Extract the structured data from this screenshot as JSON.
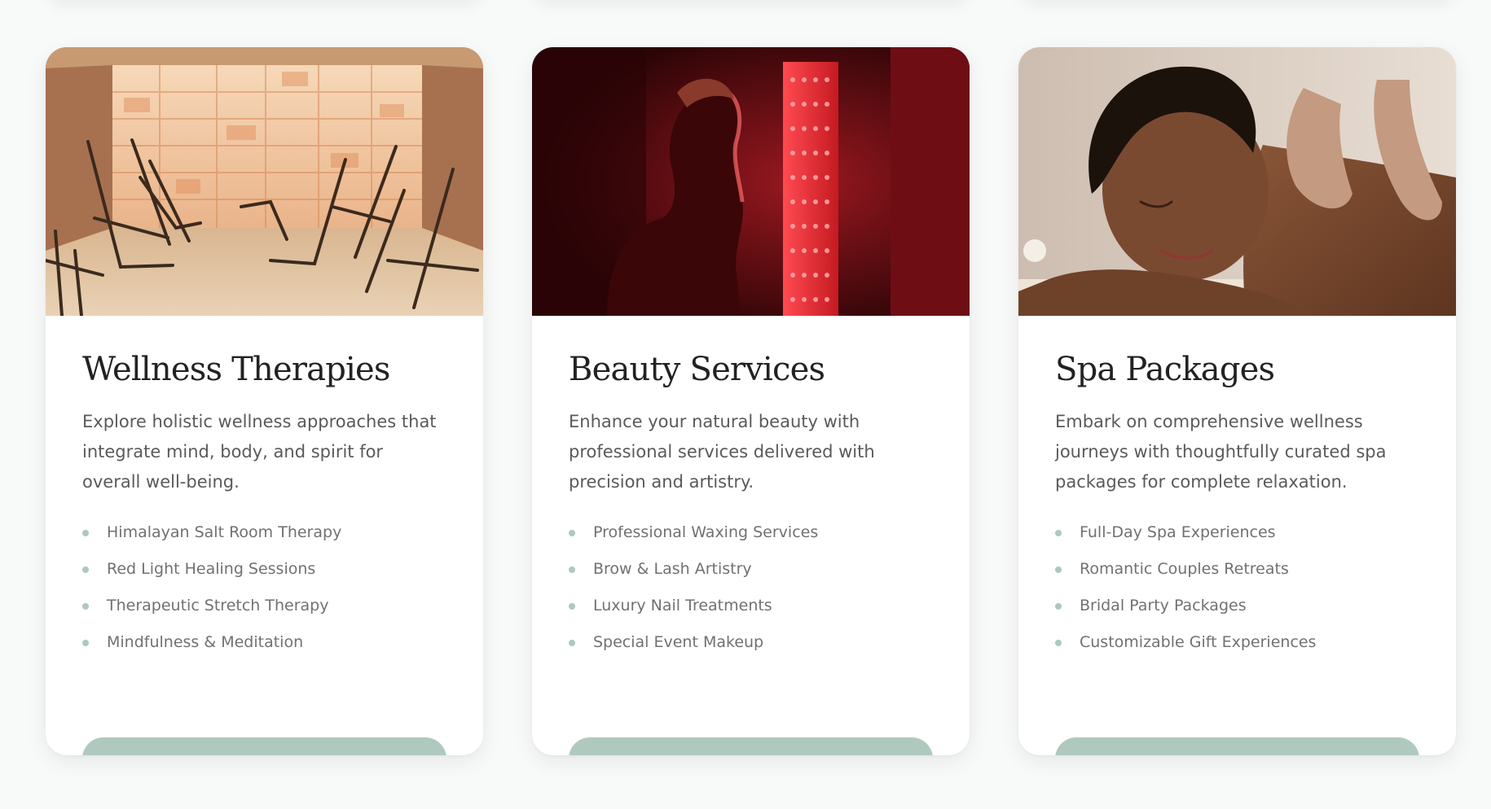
{
  "colors": {
    "page_background": "#f8f9f9",
    "card_background": "#ffffff",
    "title_text": "#222222",
    "body_text": "#5a5a5a",
    "list_text": "#717171",
    "accent_sage": "#adc8bf"
  },
  "cards": [
    {
      "image": "salt-room-photo",
      "title": "Wellness Therapies",
      "description": "Explore holistic wellness approaches that integrate mind, body, and spirit for overall well-being.",
      "items": [
        "Himalayan Salt Room Therapy",
        "Red Light Healing Sessions",
        "Therapeutic Stretch Therapy",
        "Mindfulness & Meditation"
      ],
      "button_label": ""
    },
    {
      "image": "red-light-therapy-photo",
      "title": "Beauty Services",
      "description": "Enhance your natural beauty with professional services delivered with precision and artistry.",
      "items": [
        "Professional Waxing Services",
        "Brow & Lash Artistry",
        "Luxury Nail Treatments",
        "Special Event Makeup"
      ],
      "button_label": ""
    },
    {
      "image": "massage-photo",
      "title": "Spa Packages",
      "description": "Embark on comprehensive wellness journeys with thoughtfully curated spa packages for complete relaxation.",
      "items": [
        "Full-Day Spa Experiences",
        "Romantic Couples Retreats",
        "Bridal Party Packages",
        "Customizable Gift Experiences"
      ],
      "button_label": ""
    }
  ]
}
